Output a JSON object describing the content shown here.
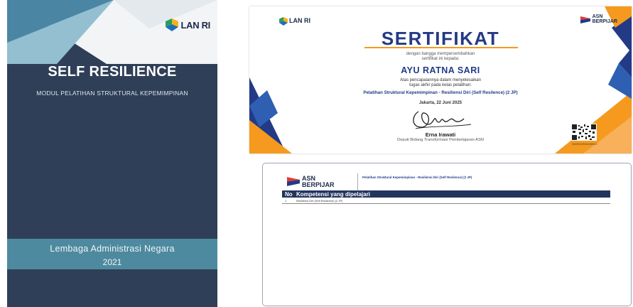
{
  "cover": {
    "logo_text": "LAN RI",
    "title": "SELF RESILIENCE",
    "subtitle": "MODUL PELATIHAN STRUKTURAL KEPEMIMPINAN",
    "org": "Lembaga Administrasi Negara",
    "year": "2021",
    "colors": {
      "background": "#2e3f57",
      "band": "#4e8a9f"
    }
  },
  "certificate": {
    "lan_logo": "LAN RI",
    "asn_logo": {
      "line1": "ASN",
      "line2": "BERPIJAR"
    },
    "title": "SERTIFIKAT",
    "intro_line1": "dengan bangga mempersembahkan",
    "intro_line2": "sertifikat ini kepada:",
    "recipient": "AYU RATNA SARI",
    "achievement_line1": "Atas pencapaiannya dalam menyelesaikan",
    "achievement_line2": "tugas akhir pada kelas pelatihan:",
    "course": "Pelatihan Struktural Kepemimpinan - Resiliensi Diri (Self Resilence) (2 JP)",
    "date": "Jakarta, 22 Juni 2025",
    "signer_name": "Erna Irawati",
    "signer_title": "Deputi Bidang Transformasi Pembelajaran ASN",
    "qr_code_text": "9MZ9KNVR9ASNB93VX",
    "colors": {
      "title": "#233a86",
      "accent": "#f59a1e",
      "navy": "#233a86"
    }
  },
  "competency": {
    "asn_logo": {
      "line1": "ASN",
      "line2": "BERPIJAR"
    },
    "course": "Pelatihan Struktural Kepemimpinan - Resiliensi Diri (Self Resilence) (2 JP)",
    "headers": [
      "No",
      "Kompetensi yang dipelajari"
    ],
    "rows": [
      {
        "no": "1",
        "name": "Resiliensi Diri (Self Resilence) (2 JP)"
      }
    ]
  }
}
